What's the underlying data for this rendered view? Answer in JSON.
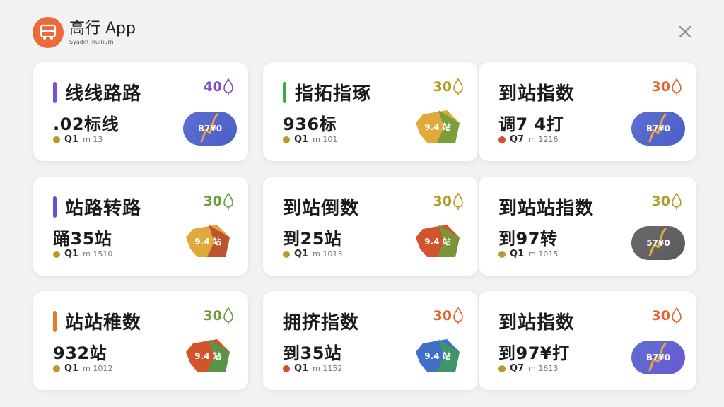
{
  "app": {
    "title": "高行 App",
    "subtitle": "Syadih inuinurn",
    "logo_icon": "bus-icon",
    "close_icon": "close-icon",
    "colors": {
      "logo": "#ec6a3a",
      "background": "#f2f2f4"
    }
  },
  "cards": [
    {
      "title": "线线路路",
      "score": "40",
      "value": ".02标线",
      "code": "Q1",
      "note": "m 13",
      "accent": "#7c4fd0",
      "score_color": "#7c4fd0",
      "dot": "#b89a2a",
      "badge_type": "pill",
      "badge_label": "B7¥0",
      "badge_colors": [
        "#5d6fd1",
        "#4a5ec8"
      ],
      "line_color": "#e8a33a"
    },
    {
      "title": "指拓指琢",
      "score": "30",
      "value": "936标",
      "code": "Q1",
      "note": "m 101",
      "accent": "#3aa84b",
      "score_color": "#b59a20",
      "dot": "#b89a2a",
      "badge_type": "tag",
      "badge_label": "9.4 站",
      "badge_colors": [
        "#e0a93b",
        "#6f9c3a"
      ]
    },
    {
      "title": "到站指数",
      "score": "30",
      "value": "调7 4打",
      "code": "Q7",
      "note": "m 1216",
      "accent": "",
      "score_color": "#e0662f",
      "dot": "#d84f2b",
      "badge_type": "pill",
      "badge_label": "B7¥0",
      "badge_colors": [
        "#5d6fd1",
        "#4a5ec8"
      ],
      "line_color": "#e8a33a"
    },
    {
      "title": "站路转路",
      "score": "30",
      "value": "踊35站",
      "code": "Q1",
      "note": "m 1510",
      "accent": "#5a55d6",
      "score_color": "#6f9c3a",
      "dot": "#b89a2a",
      "badge_type": "tag",
      "badge_label": "9.4 站",
      "badge_colors": [
        "#e0a93b",
        "#b94a2e"
      ]
    },
    {
      "title": "到站倒数",
      "score": "30",
      "value": "到25站",
      "code": "Q1",
      "note": "m 1013",
      "accent": "",
      "score_color": "#b59a20",
      "dot": "#b89a2a",
      "badge_type": "tag",
      "badge_label": "9.4 站",
      "badge_colors": [
        "#d2542d",
        "#6f9c3a"
      ]
    },
    {
      "title": "到站站指数",
      "score": "30",
      "value": "到97转",
      "code": "Q1",
      "note": "m 1015",
      "accent": "",
      "score_color": "#b59a20",
      "dot": "#b89a2a",
      "badge_type": "pill",
      "badge_label": "57¥0",
      "badge_colors": [
        "#6b6b6e",
        "#5a5a5d"
      ],
      "line_color": "#e0a93b"
    },
    {
      "title": "站站稚数",
      "score": "30",
      "value": "932站",
      "code": "Q1",
      "note": "m 1012",
      "accent": "#e87a2a",
      "score_color": "#6f9c3a",
      "dot": "#b89a2a",
      "badge_type": "tag",
      "badge_label": "9.4 站",
      "badge_colors": [
        "#d2542d",
        "#4a9c4a"
      ]
    },
    {
      "title": "拥挤指数",
      "score": "30",
      "value": "到35站",
      "code": "Q1",
      "note": "m 1152",
      "accent": "",
      "score_color": "#e0662f",
      "dot": "#d84f2b",
      "badge_type": "tag",
      "badge_label": "9.4 站",
      "badge_colors": [
        "#3f6fc8",
        "#3c9a5a"
      ]
    },
    {
      "title": "到站指数",
      "score": "30",
      "value": "到97¥打",
      "code": "Q7",
      "note": "m 1613",
      "accent": "",
      "score_color": "#e0662f",
      "dot": "#b89a2a",
      "badge_type": "pill",
      "badge_label": "B7¥0",
      "badge_colors": [
        "#5d6fd1",
        "#6a58d6"
      ],
      "line_color": "#e8a33a"
    }
  ]
}
